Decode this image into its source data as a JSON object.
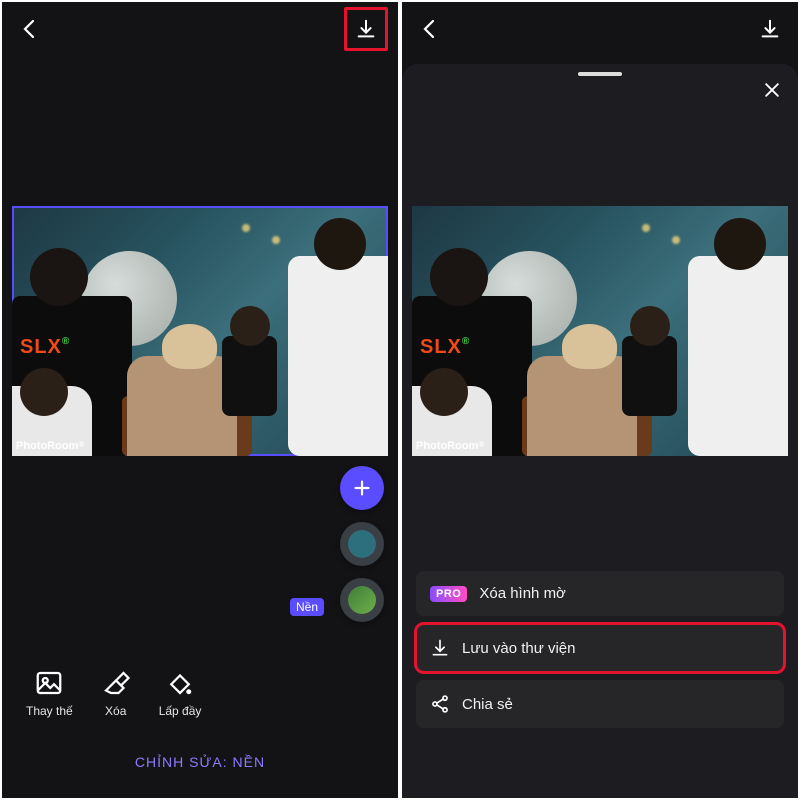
{
  "left": {
    "watermark": "PhotoRoom",
    "layer_tag": "Nền",
    "tools": {
      "replace": "Thay thế",
      "delete": "Xóa",
      "fill": "Lấp đầy"
    },
    "footer": "CHỈNH SỬA: NỀN"
  },
  "right": {
    "watermark": "PhotoRoom",
    "menu": {
      "pro_badge": "PRO",
      "remove_watermark": "Xóa hình mờ",
      "save_to_library": "Lưu vào thư viện",
      "share": "Chia sẻ"
    }
  }
}
